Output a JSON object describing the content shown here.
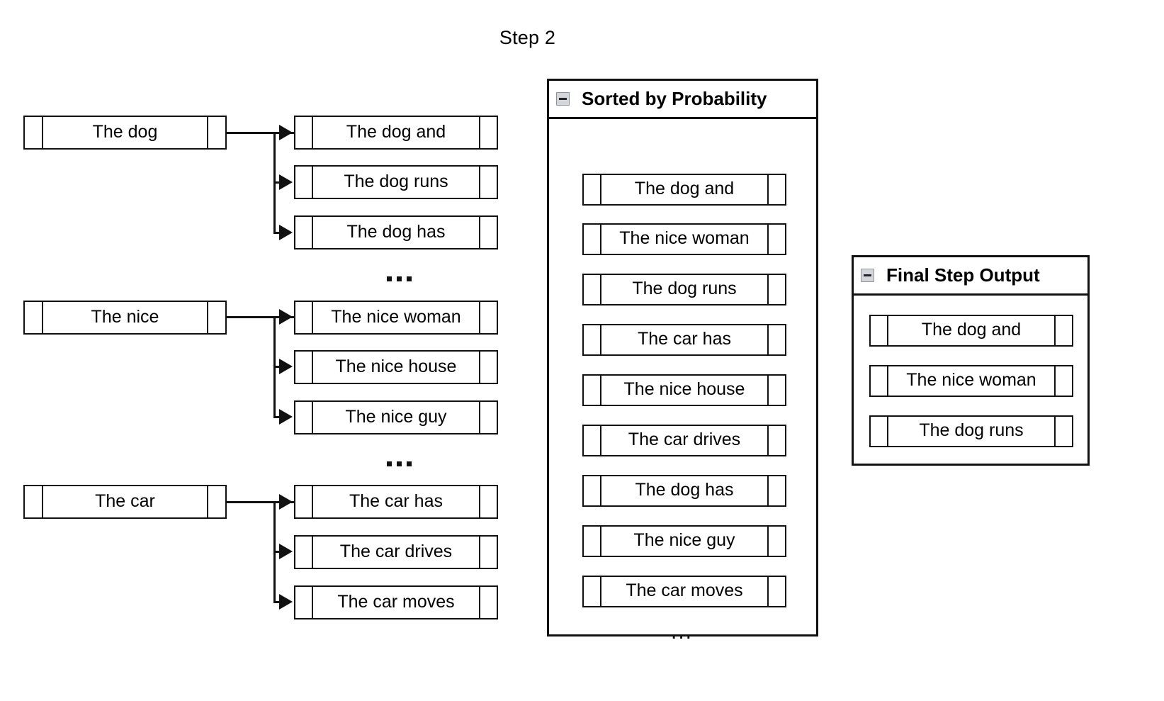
{
  "title": "Step 2",
  "prefixes": [
    {
      "text": "The dog"
    },
    {
      "text": "The nice"
    },
    {
      "text": "The car"
    }
  ],
  "expansions": [
    [
      "The dog and",
      "The dog runs",
      "The dog has"
    ],
    [
      "The nice woman",
      "The nice house",
      "The nice guy"
    ],
    [
      "The car has",
      "The car drives",
      "The car moves"
    ]
  ],
  "group_separator": "...",
  "sorted_panel": {
    "title": "Sorted by Probability",
    "collapse_icon": "minus-icon",
    "items": [
      "The dog and",
      "The nice woman",
      "The dog runs",
      "The car has",
      "The nice house",
      "The car drives",
      "The dog has",
      "The nice guy",
      "The car moves"
    ],
    "more_indicator": "..."
  },
  "final_panel": {
    "title": "Final Step Output",
    "collapse_icon": "minus-icon",
    "items": [
      "The dog and",
      "The nice woman",
      "The dog runs"
    ]
  },
  "colors": {
    "stroke": "#111111",
    "background": "#ffffff",
    "icon_fill": "#d3d7dc",
    "icon_border": "#8d939b",
    "icon_glyph": "#22262b"
  }
}
